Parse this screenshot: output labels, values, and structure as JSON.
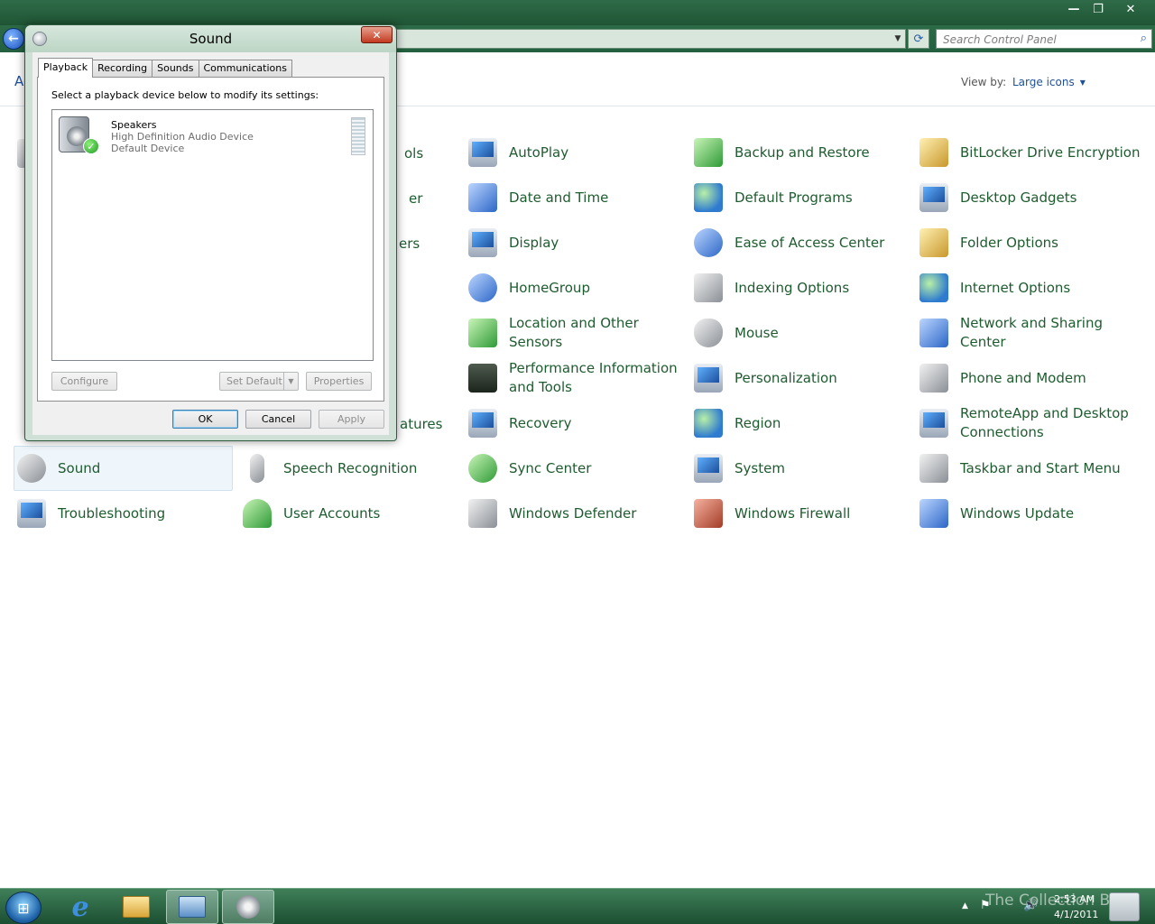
{
  "window": {
    "minimize": "—",
    "maximize": "❐",
    "close": "✕"
  },
  "address": {
    "back": "←",
    "search_placeholder": "Search Control Panel",
    "refresh": "⟳",
    "dropdown": "▼"
  },
  "header": {
    "adjust_partial": "Ad",
    "view_by_label": "View by:",
    "view_by_value": "Large icons"
  },
  "items": [
    {
      "label": "Sound",
      "icon": "speaker-icon"
    },
    {
      "label": "Speech Recognition",
      "icon": "microphone-icon"
    },
    {
      "label": "AutoPlay",
      "icon": "autoplay-icon"
    },
    {
      "label": "Backup and Restore",
      "icon": "backup-icon"
    },
    {
      "label": "BitLocker Drive Encryption",
      "icon": "bitlocker-icon"
    },
    {
      "label": "Date and Time",
      "icon": "calendar-icon"
    },
    {
      "label": "Default Programs",
      "icon": "default-programs-icon"
    },
    {
      "label": "Desktop Gadgets",
      "icon": "gadgets-icon"
    },
    {
      "label": "Display",
      "icon": "display-icon"
    },
    {
      "label": "Ease of Access Center",
      "icon": "ease-of-access-icon"
    },
    {
      "label": "Folder Options",
      "icon": "folder-options-icon"
    },
    {
      "label": "HomeGroup",
      "icon": "homegroup-icon"
    },
    {
      "label": "Indexing Options",
      "icon": "indexing-icon"
    },
    {
      "label": "Internet Options",
      "icon": "internet-options-icon"
    },
    {
      "label": "Location and Other Sensors",
      "icon": "sensors-icon"
    },
    {
      "label": "Mouse",
      "icon": "mouse-icon"
    },
    {
      "label": "Network and Sharing Center",
      "icon": "network-icon"
    },
    {
      "label": "Performance Information and Tools",
      "icon": "performance-icon"
    },
    {
      "label": "Personalization",
      "icon": "personalization-icon"
    },
    {
      "label": "Phone and Modem",
      "icon": "phone-icon"
    },
    {
      "label": "Recovery",
      "icon": "recovery-icon"
    },
    {
      "label": "Region",
      "icon": "region-icon"
    },
    {
      "label": "RemoteApp and Desktop Connections",
      "icon": "remoteapp-icon"
    },
    {
      "label": "Sync Center",
      "icon": "sync-icon"
    },
    {
      "label": "System",
      "icon": "system-icon"
    },
    {
      "label": "Taskbar and Start Menu",
      "icon": "taskbar-icon"
    },
    {
      "label": "Troubleshooting",
      "icon": "troubleshooting-icon"
    },
    {
      "label": "User Accounts",
      "icon": "user-accounts-icon"
    },
    {
      "label": "Windows Defender",
      "icon": "defender-icon"
    },
    {
      "label": "Windows Firewall",
      "icon": "firewall-icon"
    },
    {
      "label": "Windows Update",
      "icon": "windows-update-icon"
    }
  ],
  "hidden_fragments": {
    "tools": "ols",
    "manager": "er",
    "printers": "ers",
    "features": "atures"
  },
  "dialog": {
    "title": "Sound",
    "close": "✕",
    "tabs": [
      "Playback",
      "Recording",
      "Sounds",
      "Communications"
    ],
    "instruction": "Select a playback device below to modify its settings:",
    "device": {
      "name": "Speakers",
      "description": "High Definition Audio Device",
      "status": "Default Device"
    },
    "buttons": {
      "configure": "Configure",
      "set_default": "Set Default",
      "properties": "Properties",
      "ok": "OK",
      "cancel": "Cancel",
      "apply": "Apply"
    }
  },
  "taskbar": {
    "start": "⊞",
    "ie": "e",
    "tray": {
      "flag": "⚑",
      "volume": "🔊",
      "arrow": "▲"
    },
    "time": "2:53 AM",
    "date": "4/1/2011",
    "watermark": "The Collection Book"
  }
}
